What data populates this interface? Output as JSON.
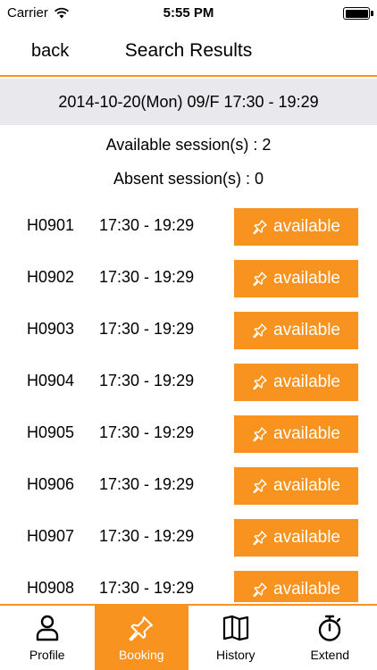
{
  "status_bar": {
    "carrier": "Carrier",
    "time": "5:55 PM"
  },
  "nav": {
    "back_label": "back",
    "title": "Search Results"
  },
  "session_header": "2014-10-20(Mon) 09/F 17:30 - 19:29",
  "summary": {
    "available": "Available session(s) : 2",
    "absent": "Absent session(s) : 0"
  },
  "rooms": [
    {
      "room": "H0901",
      "time": "17:30 - 19:29",
      "status": "available"
    },
    {
      "room": "H0902",
      "time": "17:30 - 19:29",
      "status": "available"
    },
    {
      "room": "H0903",
      "time": "17:30 - 19:29",
      "status": "available"
    },
    {
      "room": "H0904",
      "time": "17:30 - 19:29",
      "status": "available"
    },
    {
      "room": "H0905",
      "time": "17:30 - 19:29",
      "status": "available"
    },
    {
      "room": "H0906",
      "time": "17:30 - 19:29",
      "status": "available"
    },
    {
      "room": "H0907",
      "time": "17:30 - 19:29",
      "status": "available"
    },
    {
      "room": "H0908",
      "time": "17:30 - 19:29",
      "status": "available"
    }
  ],
  "tabs": [
    {
      "label": "Profile",
      "icon": "person-icon"
    },
    {
      "label": "Booking",
      "icon": "pin-icon"
    },
    {
      "label": "History",
      "icon": "book-icon"
    },
    {
      "label": "Extend",
      "icon": "stopwatch-icon"
    }
  ],
  "colors": {
    "accent": "#f7931e",
    "header_bg": "#e8e8ed"
  }
}
